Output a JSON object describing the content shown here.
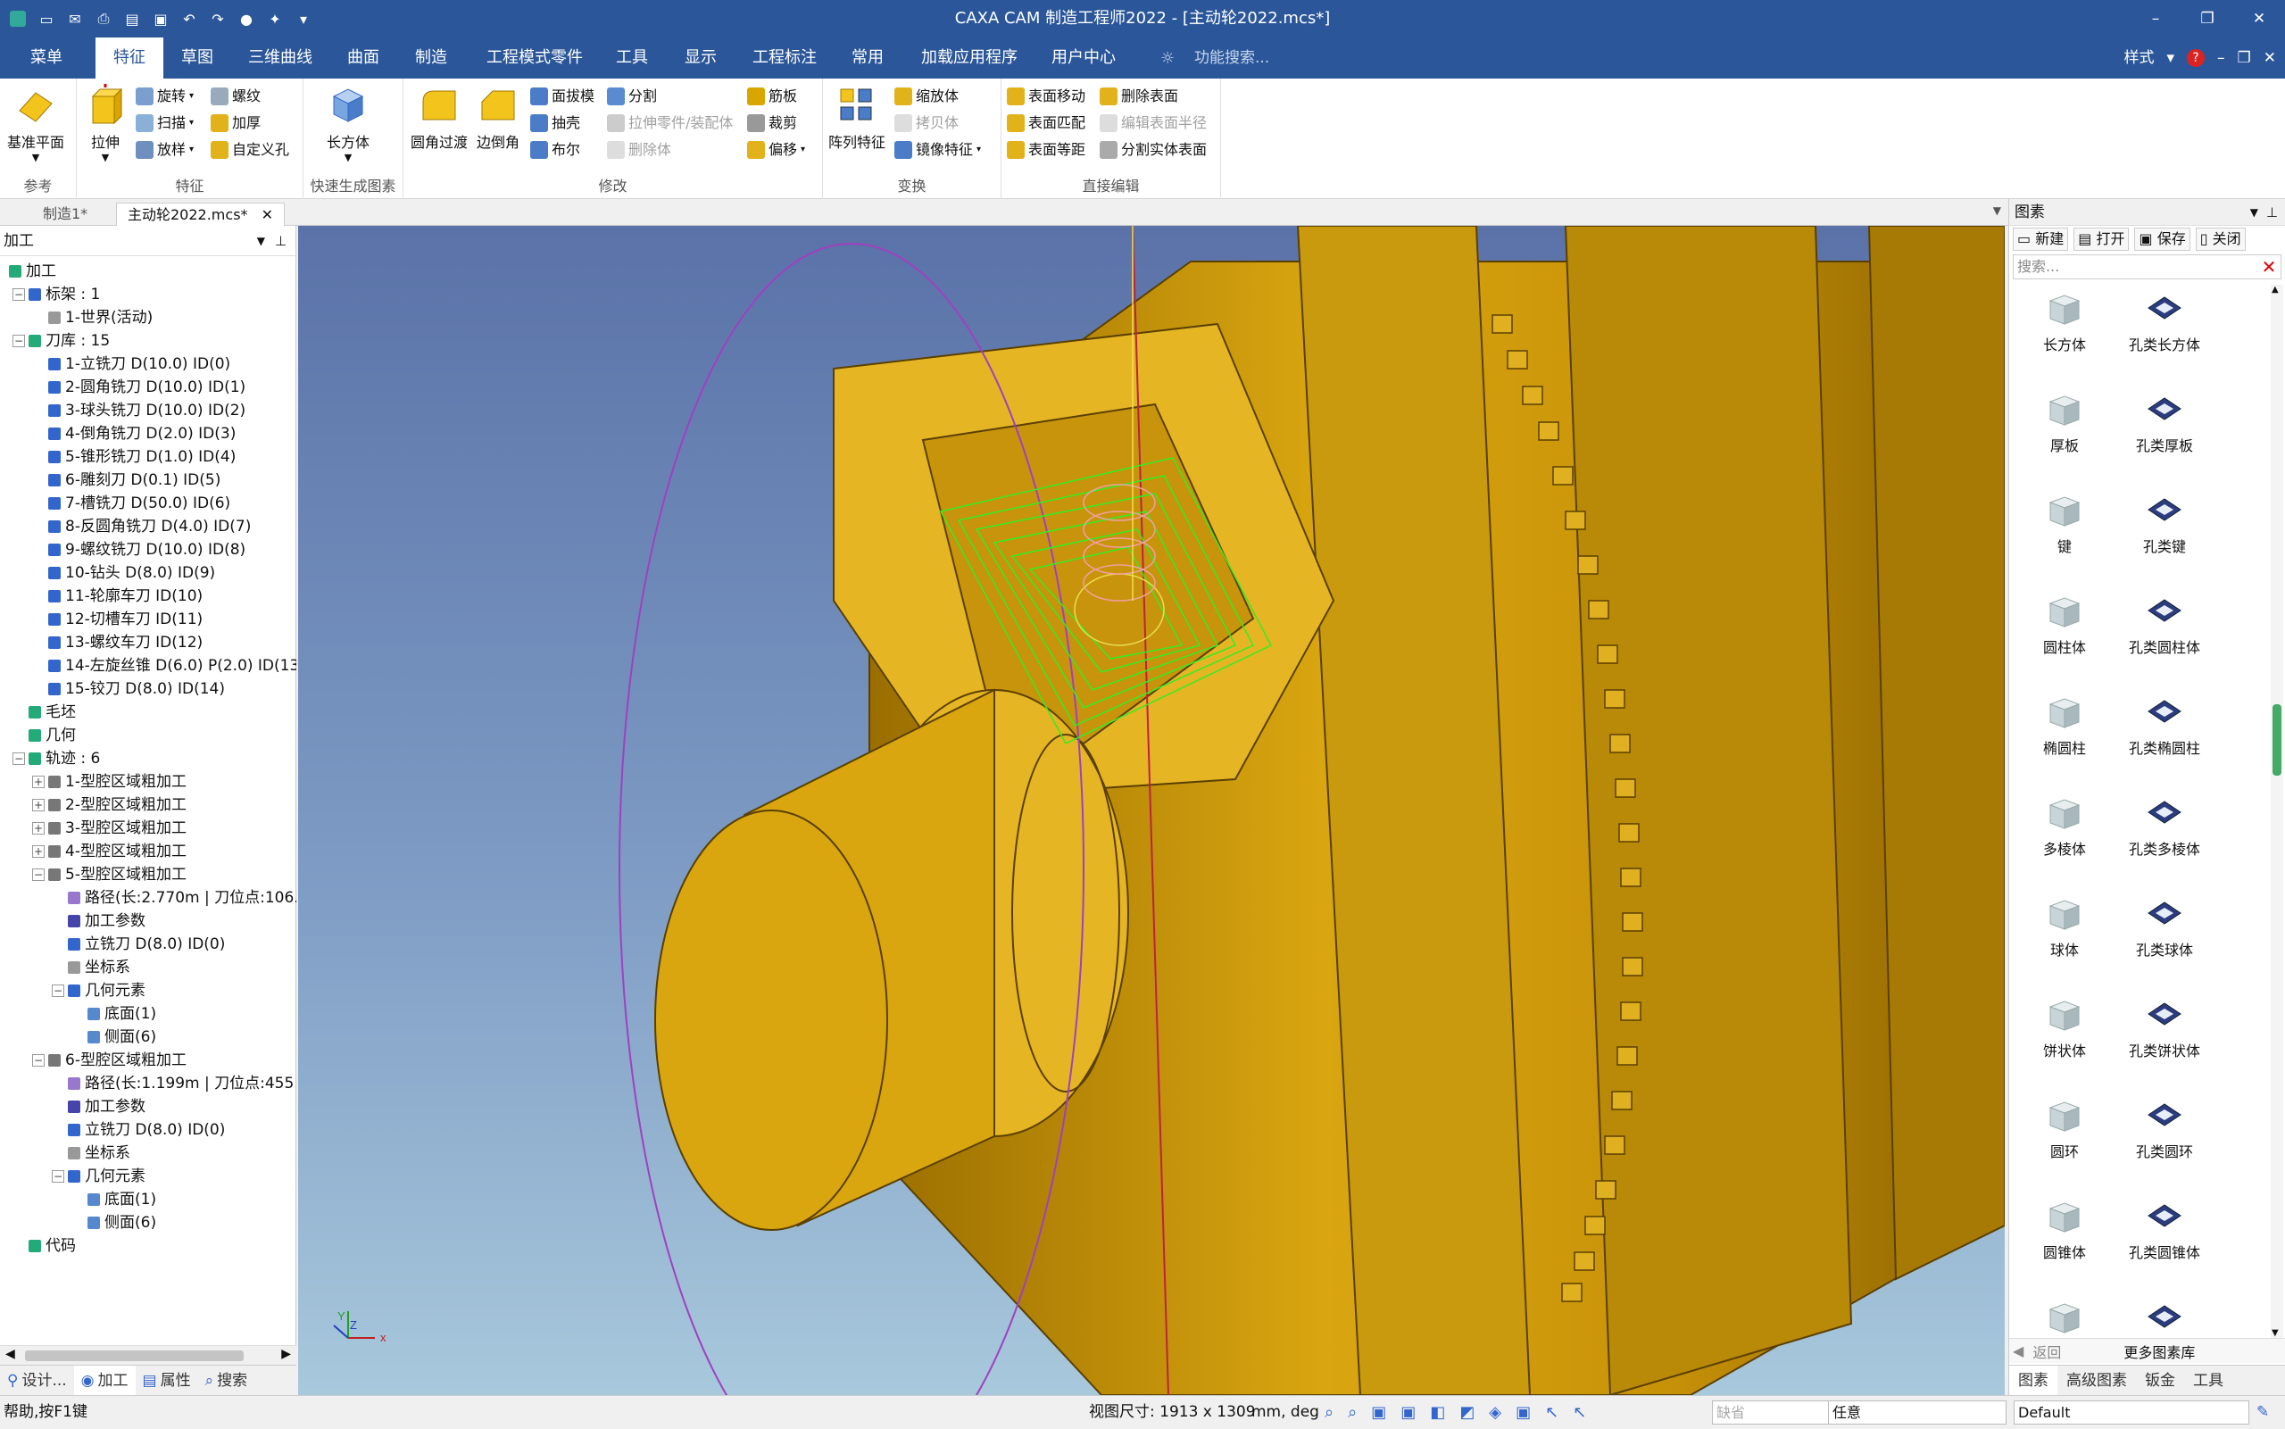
{
  "window": {
    "title": "CAXA CAM 制造工程师2022 - [主动轮2022.mcs*]",
    "controls": [
      "–",
      "❐",
      "✕"
    ]
  },
  "menu": {
    "tabs": [
      "菜单",
      "特征",
      "草图",
      "三维曲线",
      "曲面",
      "制造",
      "工程模式零件",
      "工具",
      "显示",
      "工程标注",
      "常用",
      "加载应用程序",
      "用户中心"
    ],
    "search_placeholder": "功能搜索...",
    "style_label": "样式",
    "right_controls": [
      "–",
      "❐",
      "✕"
    ]
  },
  "ribbon": {
    "groups": {
      "reference": {
        "label": "参考",
        "big": "基准平面"
      },
      "feature": {
        "label": "特征",
        "big": "拉伸",
        "small": [
          "旋转",
          "螺纹",
          "扫描",
          "加厚",
          "放样",
          "自定义孔"
        ]
      },
      "quick": {
        "label": "快速生成图素",
        "big": "长方体"
      },
      "modify": {
        "label": "修改",
        "big1": "圆角过渡",
        "big2": "边倒角",
        "small": [
          "面拔模",
          "分割",
          "筋板",
          "抽壳",
          "拉伸零件/装配体",
          "裁剪",
          "布尔",
          "删除体",
          "偏移"
        ]
      },
      "transform": {
        "label": "变换",
        "big": "阵列特征",
        "small": [
          "缩放体",
          "拷贝体",
          "镜像特征"
        ]
      },
      "direct": {
        "label": "直接编辑",
        "small": [
          "表面移动",
          "删除表面",
          "表面匹配",
          "编辑表面半径",
          "表面等距",
          "分割实体表面"
        ]
      }
    }
  },
  "doc_tabs": [
    "制造1*",
    "主动轮2022.mcs*"
  ],
  "left_panel": {
    "title": "加工",
    "tree": [
      {
        "text": "加工",
        "level": 0,
        "icon": "#2a7"
      },
      {
        "text": "标架 : 1",
        "level": 1,
        "exp": "−",
        "icon": "#36c"
      },
      {
        "text": "1-世界(活动)",
        "level": 2,
        "icon": "#999"
      },
      {
        "text": "刀库 : 15",
        "level": 1,
        "exp": "−",
        "icon": "#2a7"
      },
      {
        "text": "1-立铣刀 D(10.0) ID(0)",
        "level": 2,
        "icon": "#36c"
      },
      {
        "text": "2-圆角铣刀 D(10.0) ID(1)",
        "level": 2,
        "icon": "#36c"
      },
      {
        "text": "3-球头铣刀 D(10.0) ID(2)",
        "level": 2,
        "icon": "#36c"
      },
      {
        "text": "4-倒角铣刀 D(2.0) ID(3)",
        "level": 2,
        "icon": "#36c"
      },
      {
        "text": "5-锥形铣刀 D(1.0) ID(4)",
        "level": 2,
        "icon": "#36c"
      },
      {
        "text": "6-雕刻刀 D(0.1) ID(5)",
        "level": 2,
        "icon": "#36c"
      },
      {
        "text": "7-槽铣刀 D(50.0) ID(6)",
        "level": 2,
        "icon": "#36c"
      },
      {
        "text": "8-反圆角铣刀 D(4.0) ID(7)",
        "level": 2,
        "icon": "#36c"
      },
      {
        "text": "9-螺纹铣刀 D(10.0) ID(8)",
        "level": 2,
        "icon": "#36c"
      },
      {
        "text": "10-钻头 D(8.0) ID(9)",
        "level": 2,
        "icon": "#36c"
      },
      {
        "text": "11-轮廓车刀 ID(10)",
        "level": 2,
        "icon": "#36c"
      },
      {
        "text": "12-切槽车刀 ID(11)",
        "level": 2,
        "icon": "#36c"
      },
      {
        "text": "13-螺纹车刀 ID(12)",
        "level": 2,
        "icon": "#36c"
      },
      {
        "text": "14-左旋丝锥 D(6.0) P(2.0) ID(13",
        "level": 2,
        "icon": "#36c"
      },
      {
        "text": "15-铰刀 D(8.0) ID(14)",
        "level": 2,
        "icon": "#36c"
      },
      {
        "text": "毛坯",
        "level": 1,
        "icon": "#2a7"
      },
      {
        "text": "几何",
        "level": 1,
        "icon": "#2a7"
      },
      {
        "text": "轨迹 : 6",
        "level": 1,
        "exp": "−",
        "icon": "#2a7"
      },
      {
        "text": "1-型腔区域粗加工",
        "level": 2,
        "exp": "+",
        "icon": "#777"
      },
      {
        "text": "2-型腔区域粗加工",
        "level": 2,
        "exp": "+",
        "icon": "#777"
      },
      {
        "text": "3-型腔区域粗加工",
        "level": 2,
        "exp": "+",
        "icon": "#777"
      },
      {
        "text": "4-型腔区域粗加工",
        "level": 2,
        "exp": "+",
        "icon": "#777"
      },
      {
        "text": "5-型腔区域粗加工",
        "level": 2,
        "exp": "−",
        "icon": "#777"
      },
      {
        "text": "路径(长:2.770m | 刀位点:106.",
        "level": 3,
        "icon": "#97c"
      },
      {
        "text": "加工参数",
        "level": 3,
        "icon": "#44a"
      },
      {
        "text": "立铣刀 D(8.0) ID(0)",
        "level": 3,
        "icon": "#36c"
      },
      {
        "text": "坐标系",
        "level": 3,
        "icon": "#999"
      },
      {
        "text": "几何元素",
        "level": 3,
        "exp": "−",
        "icon": "#36c"
      },
      {
        "text": "底面(1)",
        "level": 4,
        "icon": "#58c"
      },
      {
        "text": "侧面(6)",
        "level": 4,
        "icon": "#58c"
      },
      {
        "text": "6-型腔区域粗加工",
        "level": 2,
        "exp": "−",
        "icon": "#777"
      },
      {
        "text": "路径(长:1.199m | 刀位点:455",
        "level": 3,
        "icon": "#97c"
      },
      {
        "text": "加工参数",
        "level": 3,
        "icon": "#44a"
      },
      {
        "text": "立铣刀 D(8.0) ID(0)",
        "level": 3,
        "icon": "#36c"
      },
      {
        "text": "坐标系",
        "level": 3,
        "icon": "#999"
      },
      {
        "text": "几何元素",
        "level": 3,
        "exp": "−",
        "icon": "#36c"
      },
      {
        "text": "底面(1)",
        "level": 4,
        "icon": "#58c"
      },
      {
        "text": "侧面(6)",
        "level": 4,
        "icon": "#58c"
      },
      {
        "text": "代码",
        "level": 1,
        "icon": "#2a7"
      }
    ],
    "bottom_tabs": [
      "设计...",
      "加工",
      "属性",
      "搜索"
    ]
  },
  "right_panel": {
    "title": "图素",
    "buttons": [
      "新建",
      "打开",
      "保存",
      "关闭"
    ],
    "search_placeholder": "搜索...",
    "shapes": [
      {
        "left": "长方体",
        "right": "孔类长方体"
      },
      {
        "left": "厚板",
        "right": "孔类厚板"
      },
      {
        "left": "键",
        "right": "孔类键"
      },
      {
        "left": "圆柱体",
        "right": "孔类圆柱体"
      },
      {
        "left": "椭圆柱",
        "right": "孔类椭圆柱"
      },
      {
        "left": "多棱体",
        "right": "孔类多棱体"
      },
      {
        "left": "球体",
        "right": "孔类球体"
      },
      {
        "left": "饼状体",
        "right": "孔类饼状体"
      },
      {
        "left": "圆环",
        "right": "孔类圆环"
      },
      {
        "left": "圆锥体",
        "right": "孔类圆锥体"
      },
      {
        "left": "",
        "right": ""
      }
    ],
    "back_label": "返回",
    "more_label": "更多图素库",
    "tabs": [
      "图素",
      "高级图素",
      "钣金",
      "工具"
    ]
  },
  "status": {
    "help": "帮助,按F1键",
    "view_size": "视图尺寸: 1913 x 1309",
    "units": "mm, deg",
    "default_box": "缺省",
    "any_box": "任意",
    "style_box": "Default"
  },
  "axis_labels": {
    "x": "x",
    "y": "Y",
    "z": "Z"
  },
  "colors": {
    "accent": "#2b579a",
    "model": "#c8960a",
    "toolpath": "#33ee22"
  }
}
